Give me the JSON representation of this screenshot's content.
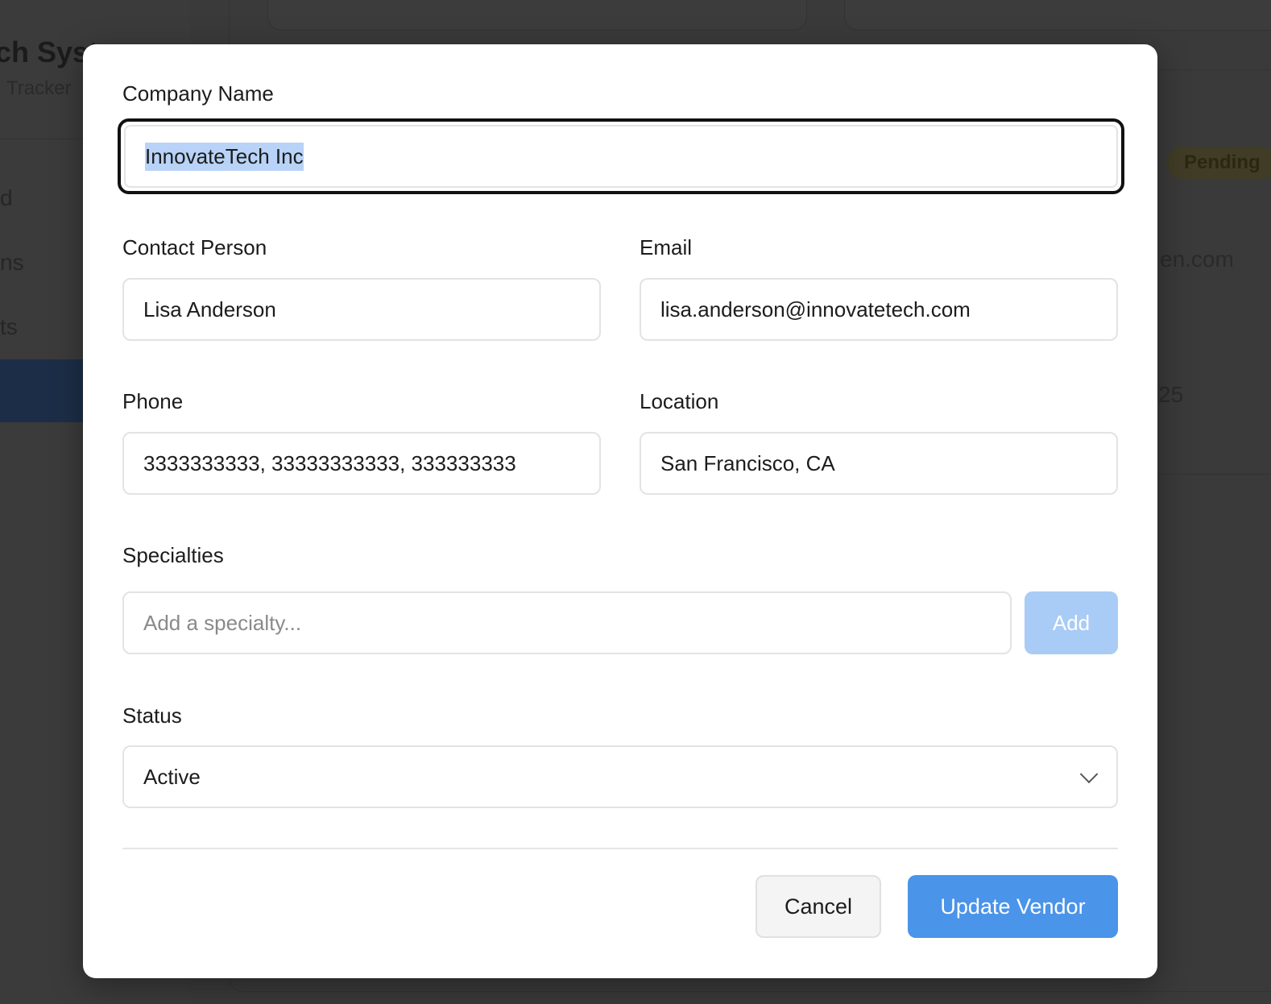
{
  "background": {
    "brand_title": "ch Syst",
    "brand_subtitle": "Tracker",
    "nav_fragments": [
      "d",
      "ns",
      "ts"
    ],
    "pending_badge": "Pending",
    "email_fragment": "en.com",
    "number_fragment": "25"
  },
  "modal": {
    "company": {
      "label": "Company Name",
      "value": "InnovateTech Inc"
    },
    "contact": {
      "label": "Contact Person",
      "value": "Lisa Anderson"
    },
    "email": {
      "label": "Email",
      "value": "lisa.anderson@innovatetech.com"
    },
    "phone": {
      "label": "Phone",
      "value": "3333333333, 33333333333, 333333333"
    },
    "location": {
      "label": "Location",
      "value": "San Francisco, CA"
    },
    "specialties": {
      "label": "Specialties",
      "placeholder": "Add a specialty...",
      "add_label": "Add"
    },
    "status": {
      "label": "Status",
      "value": "Active"
    },
    "actions": {
      "cancel_label": "Cancel",
      "submit_label": "Update Vendor"
    }
  },
  "colors": {
    "primary": "#4a94e9",
    "primary_disabled": "#a8ccf5",
    "selection": "#b8d3f7",
    "overlay": "#3a3a3a"
  }
}
